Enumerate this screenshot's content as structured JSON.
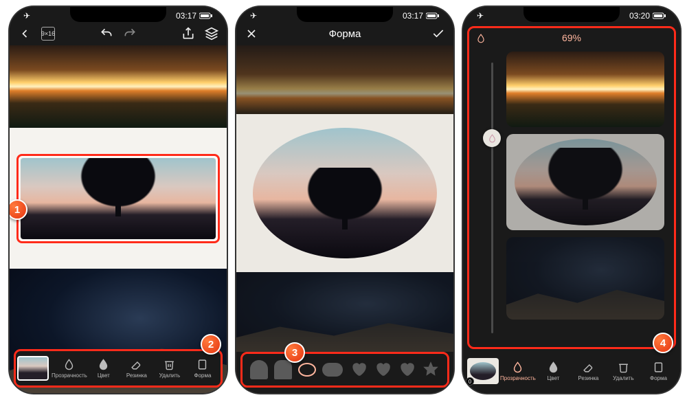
{
  "status": {
    "time1": "03:17",
    "time2": "03:17",
    "time3": "03:20",
    "airplane": "✈",
    "wifi": "wifi",
    "battery": "batt"
  },
  "screen1": {
    "aspect_label": "9×16",
    "toolbar": {
      "opacity": "Прозрачность",
      "color": "Цвет",
      "eraser": "Резинка",
      "delete": "Удалить",
      "shape": "Форма"
    }
  },
  "screen2": {
    "title": "Форма"
  },
  "screen3": {
    "percent": "69%",
    "thumb_count": "0",
    "toolbar": {
      "opacity": "Прозрачность",
      "color": "Цвет",
      "eraser": "Резинка",
      "delete": "Удалить",
      "shape": "Форма"
    }
  },
  "badges": {
    "b1": "1",
    "b2": "2",
    "b3": "3",
    "b4": "4"
  }
}
